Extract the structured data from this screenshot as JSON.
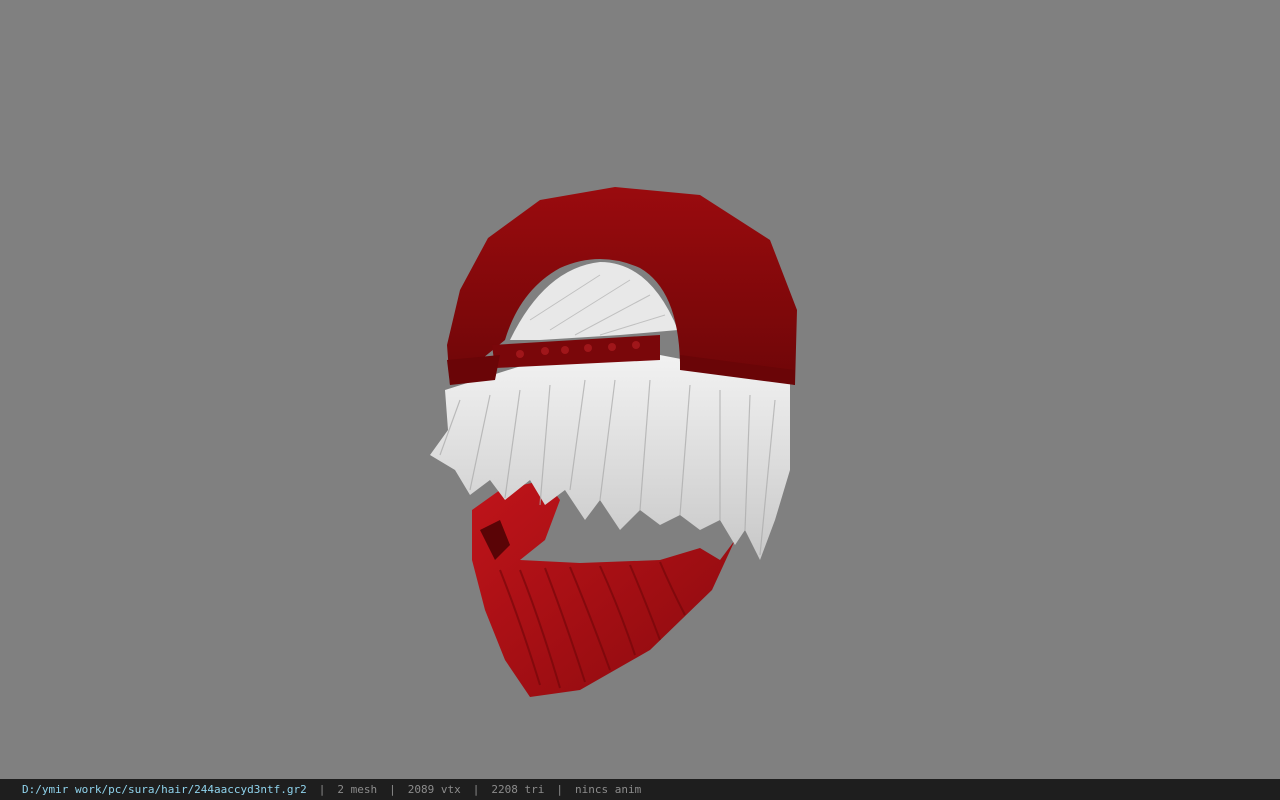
{
  "viewer": {
    "background_color": "#808080",
    "model": {
      "parts": [
        "cap",
        "hair",
        "face-mask"
      ],
      "cap_color": "#8e0a0c",
      "hair_color": "#e6e6e6",
      "mask_color": "#b01015"
    }
  },
  "status_bar": {
    "file_path": "D:/ymir work/pc/sura/hair/244aaccyd3ntf.gr2",
    "separator": "|",
    "mesh_count": "2 mesh",
    "vertex_count": "2089 vtx",
    "triangle_count": "2208 tri",
    "anim_status": "nincs anim",
    "path_color": "#8fd3ec",
    "text_color": "#8c8c8c"
  }
}
